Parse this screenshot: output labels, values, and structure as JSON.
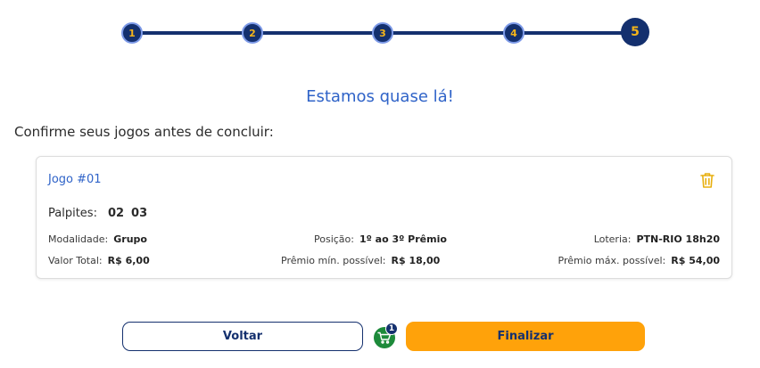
{
  "stepper": {
    "steps": [
      "1",
      "2",
      "3",
      "4",
      "5"
    ],
    "active_step": "5"
  },
  "headline": "Estamos quase lá!",
  "subtitle": "Confirme seus jogos antes de concluir:",
  "game": {
    "title": "Jogo #01",
    "picks_label": "Palpites:",
    "picks": [
      "02",
      "03"
    ],
    "modalidade_label": "Modalidade:",
    "modalidade_value": "Grupo",
    "posicao_label": "Posição:",
    "posicao_value": "1º ao 3º Prêmio",
    "loteria_label": "Loteria:",
    "loteria_value": "PTN-RIO 18h20",
    "valor_label": "Valor Total:",
    "valor_value": "R$ 6,00",
    "premio_min_label": "Prêmio mín. possível:",
    "premio_min_value": "R$ 18,00",
    "premio_max_label": "Prêmio máx. possível:",
    "premio_max_value": "R$ 54,00"
  },
  "actions": {
    "back_label": "Voltar",
    "finish_label": "Finalizar",
    "cart_count": "1"
  },
  "colors": {
    "primary_navy": "#14306e",
    "accent_yellow": "#f4b41a",
    "link_blue": "#2f63c8",
    "finish_orange": "#ffa20a",
    "cart_green": "#1d8a3a"
  },
  "icons": {
    "trash": "trash-icon",
    "cart": "cart-icon"
  }
}
